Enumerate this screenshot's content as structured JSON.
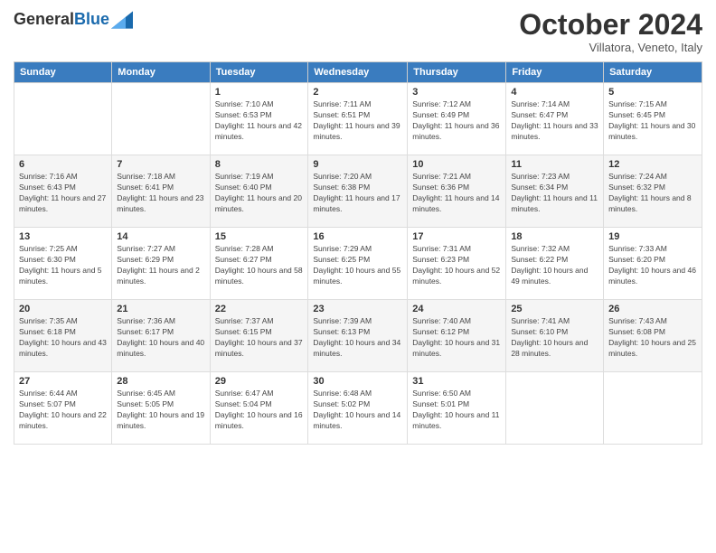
{
  "header": {
    "logo_general": "General",
    "logo_blue": "Blue",
    "month_title": "October 2024",
    "subtitle": "Villatora, Veneto, Italy"
  },
  "days_of_week": [
    "Sunday",
    "Monday",
    "Tuesday",
    "Wednesday",
    "Thursday",
    "Friday",
    "Saturday"
  ],
  "weeks": [
    [
      {
        "day": "",
        "info": ""
      },
      {
        "day": "",
        "info": ""
      },
      {
        "day": "1",
        "info": "Sunrise: 7:10 AM\nSunset: 6:53 PM\nDaylight: 11 hours and 42 minutes."
      },
      {
        "day": "2",
        "info": "Sunrise: 7:11 AM\nSunset: 6:51 PM\nDaylight: 11 hours and 39 minutes."
      },
      {
        "day": "3",
        "info": "Sunrise: 7:12 AM\nSunset: 6:49 PM\nDaylight: 11 hours and 36 minutes."
      },
      {
        "day": "4",
        "info": "Sunrise: 7:14 AM\nSunset: 6:47 PM\nDaylight: 11 hours and 33 minutes."
      },
      {
        "day": "5",
        "info": "Sunrise: 7:15 AM\nSunset: 6:45 PM\nDaylight: 11 hours and 30 minutes."
      }
    ],
    [
      {
        "day": "6",
        "info": "Sunrise: 7:16 AM\nSunset: 6:43 PM\nDaylight: 11 hours and 27 minutes."
      },
      {
        "day": "7",
        "info": "Sunrise: 7:18 AM\nSunset: 6:41 PM\nDaylight: 11 hours and 23 minutes."
      },
      {
        "day": "8",
        "info": "Sunrise: 7:19 AM\nSunset: 6:40 PM\nDaylight: 11 hours and 20 minutes."
      },
      {
        "day": "9",
        "info": "Sunrise: 7:20 AM\nSunset: 6:38 PM\nDaylight: 11 hours and 17 minutes."
      },
      {
        "day": "10",
        "info": "Sunrise: 7:21 AM\nSunset: 6:36 PM\nDaylight: 11 hours and 14 minutes."
      },
      {
        "day": "11",
        "info": "Sunrise: 7:23 AM\nSunset: 6:34 PM\nDaylight: 11 hours and 11 minutes."
      },
      {
        "day": "12",
        "info": "Sunrise: 7:24 AM\nSunset: 6:32 PM\nDaylight: 11 hours and 8 minutes."
      }
    ],
    [
      {
        "day": "13",
        "info": "Sunrise: 7:25 AM\nSunset: 6:30 PM\nDaylight: 11 hours and 5 minutes."
      },
      {
        "day": "14",
        "info": "Sunrise: 7:27 AM\nSunset: 6:29 PM\nDaylight: 11 hours and 2 minutes."
      },
      {
        "day": "15",
        "info": "Sunrise: 7:28 AM\nSunset: 6:27 PM\nDaylight: 10 hours and 58 minutes."
      },
      {
        "day": "16",
        "info": "Sunrise: 7:29 AM\nSunset: 6:25 PM\nDaylight: 10 hours and 55 minutes."
      },
      {
        "day": "17",
        "info": "Sunrise: 7:31 AM\nSunset: 6:23 PM\nDaylight: 10 hours and 52 minutes."
      },
      {
        "day": "18",
        "info": "Sunrise: 7:32 AM\nSunset: 6:22 PM\nDaylight: 10 hours and 49 minutes."
      },
      {
        "day": "19",
        "info": "Sunrise: 7:33 AM\nSunset: 6:20 PM\nDaylight: 10 hours and 46 minutes."
      }
    ],
    [
      {
        "day": "20",
        "info": "Sunrise: 7:35 AM\nSunset: 6:18 PM\nDaylight: 10 hours and 43 minutes."
      },
      {
        "day": "21",
        "info": "Sunrise: 7:36 AM\nSunset: 6:17 PM\nDaylight: 10 hours and 40 minutes."
      },
      {
        "day": "22",
        "info": "Sunrise: 7:37 AM\nSunset: 6:15 PM\nDaylight: 10 hours and 37 minutes."
      },
      {
        "day": "23",
        "info": "Sunrise: 7:39 AM\nSunset: 6:13 PM\nDaylight: 10 hours and 34 minutes."
      },
      {
        "day": "24",
        "info": "Sunrise: 7:40 AM\nSunset: 6:12 PM\nDaylight: 10 hours and 31 minutes."
      },
      {
        "day": "25",
        "info": "Sunrise: 7:41 AM\nSunset: 6:10 PM\nDaylight: 10 hours and 28 minutes."
      },
      {
        "day": "26",
        "info": "Sunrise: 7:43 AM\nSunset: 6:08 PM\nDaylight: 10 hours and 25 minutes."
      }
    ],
    [
      {
        "day": "27",
        "info": "Sunrise: 6:44 AM\nSunset: 5:07 PM\nDaylight: 10 hours and 22 minutes."
      },
      {
        "day": "28",
        "info": "Sunrise: 6:45 AM\nSunset: 5:05 PM\nDaylight: 10 hours and 19 minutes."
      },
      {
        "day": "29",
        "info": "Sunrise: 6:47 AM\nSunset: 5:04 PM\nDaylight: 10 hours and 16 minutes."
      },
      {
        "day": "30",
        "info": "Sunrise: 6:48 AM\nSunset: 5:02 PM\nDaylight: 10 hours and 14 minutes."
      },
      {
        "day": "31",
        "info": "Sunrise: 6:50 AM\nSunset: 5:01 PM\nDaylight: 10 hours and 11 minutes."
      },
      {
        "day": "",
        "info": ""
      },
      {
        "day": "",
        "info": ""
      }
    ]
  ]
}
